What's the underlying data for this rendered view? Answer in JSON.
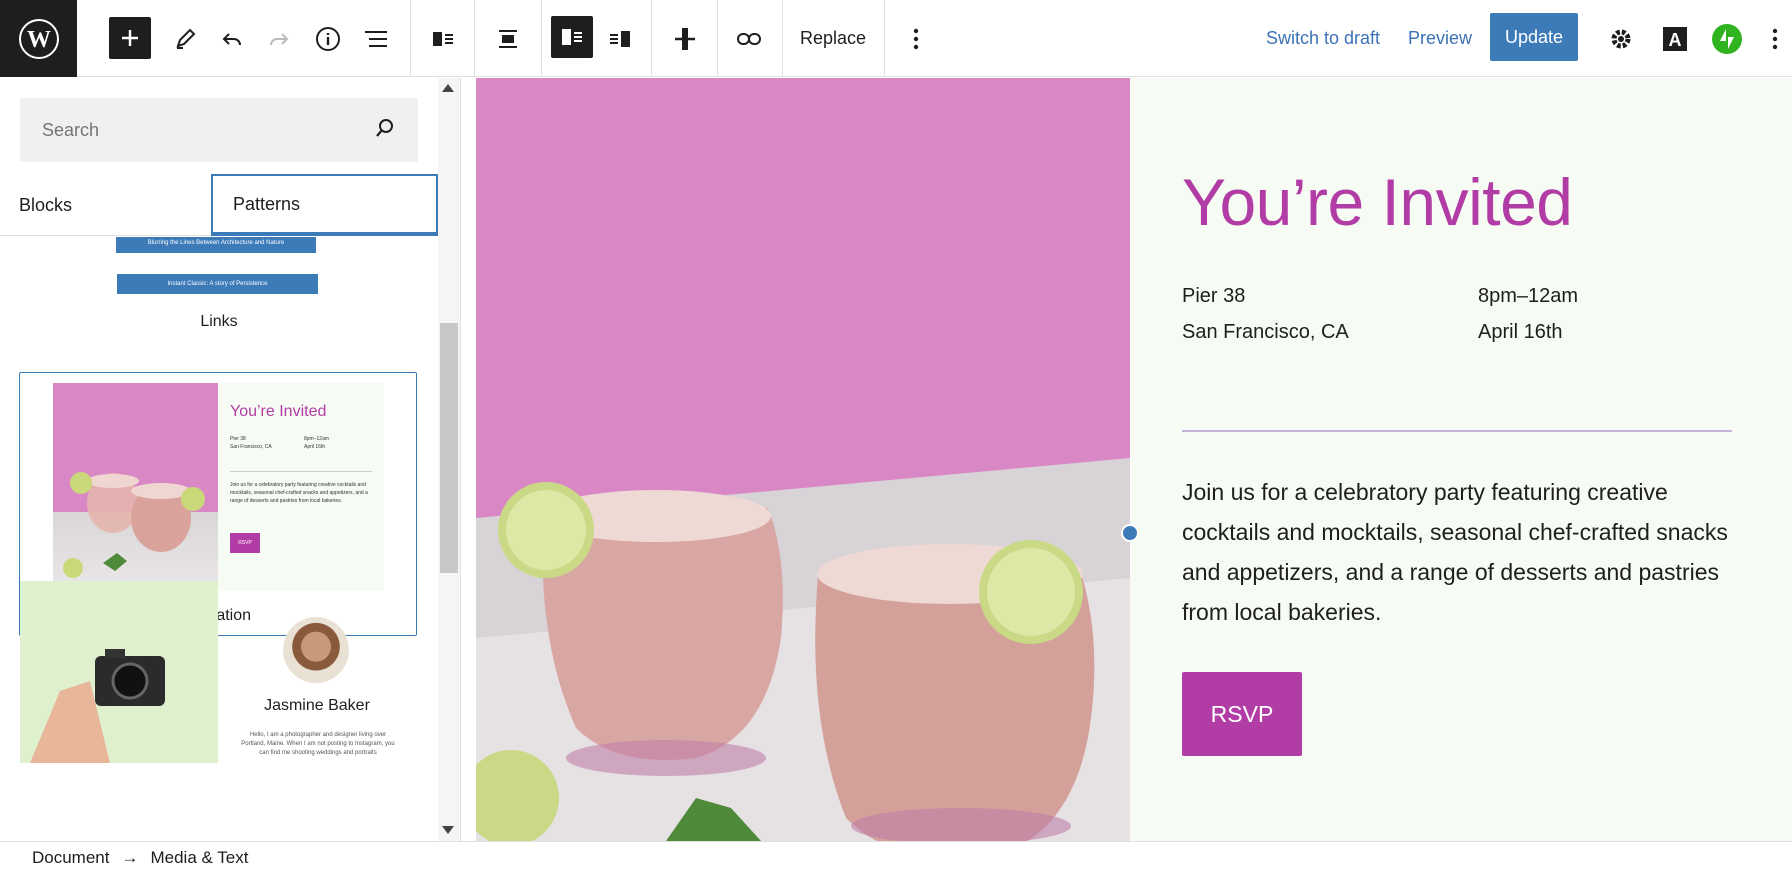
{
  "toolbar": {
    "replace_label": "Replace",
    "switch_draft_label": "Switch to draft",
    "preview_label": "Preview",
    "update_label": "Update"
  },
  "sidebar": {
    "search_placeholder": "Search",
    "tabs": [
      {
        "label": "Blocks"
      },
      {
        "label": "Patterns"
      }
    ],
    "links_pattern": {
      "bar1": "Blurring the Lines Between Architecture and Nature",
      "bar2": "Instant Classic: A story of Persistence",
      "label": "Links"
    },
    "invitation_pattern": {
      "title": "You’re Invited",
      "place1": "Pier 38",
      "place2": "San Francisco, CA",
      "time": "8pm–12am",
      "date": "April 16th",
      "body": "Join us for a celebratory party featuring creative cocktails and mocktails, seasonal chef-crafted snacks and appetizers, and a range of desserts and pastries from local bakeries.",
      "rsvp": "RSVP",
      "label": "Invitation"
    },
    "profile_pattern": {
      "name": "Jasmine Baker",
      "bio": "Hello, I am a photographer and designer living over Portland, Maine. When I am not posting to Instagram, you can find me shooting weddings and portraits"
    }
  },
  "canvas": {
    "title": "You’re Invited",
    "place_line1": "Pier 38",
    "place_line2": "San Francisco, CA",
    "time": "8pm–12am",
    "date": "April 16th",
    "body": "Join us for a celebratory party featuring creative cocktails and mocktails, seasonal chef-crafted snacks and appetizers, and a range of desserts and pastries from local bakeries.",
    "rsvp_label": "RSVP"
  },
  "breadcrumb": {
    "document": "Document",
    "arrow": "→",
    "current": "Media & Text"
  },
  "colors": {
    "accent": "#3c7ab8",
    "brand_magenta": "#b23ca5",
    "photo_pink": "#da88c5",
    "text_panel_bg": "#f6fbf4"
  }
}
